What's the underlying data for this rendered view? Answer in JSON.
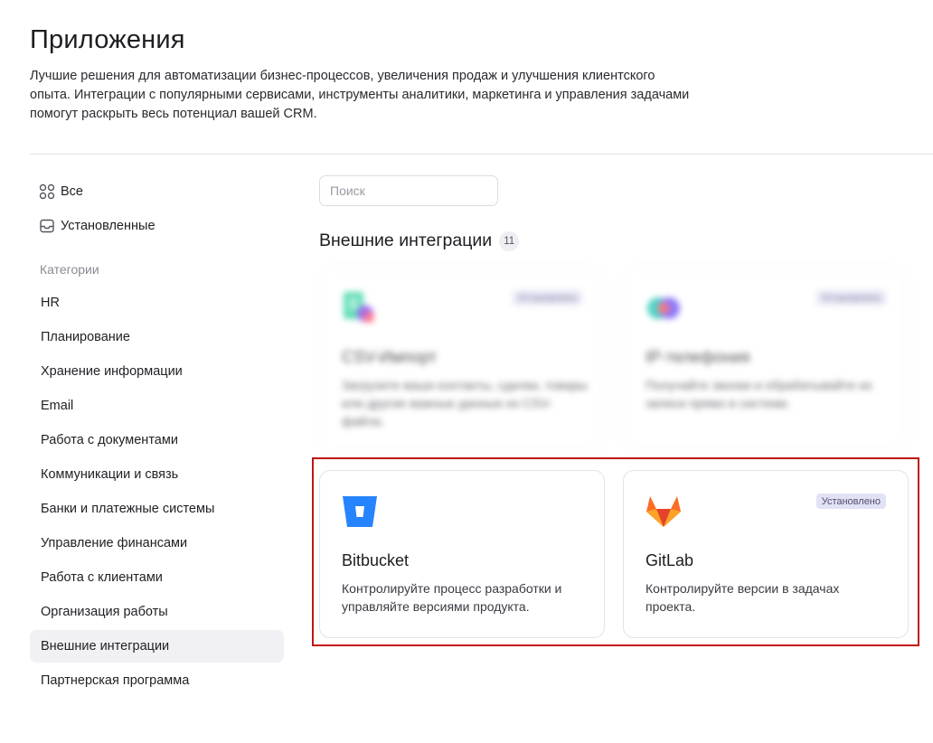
{
  "header": {
    "title": "Приложения",
    "description": "Лучшие решения для автоматизации бизнес-процессов, увеличения продаж и улучшения клиентского опыта. Интеграции с популярными сервисами, инструменты аналитики, маркетинга и управления задачами помогут раскрыть весь потенциал вашей CRM."
  },
  "sidebar": {
    "all_label": "Все",
    "installed_label": "Установленные",
    "categories_title": "Категории",
    "categories": [
      "HR",
      "Планирование",
      "Хранение информации",
      "Email",
      "Работа с документами",
      "Коммуникации и связь",
      "Банки и платежные системы",
      "Управление финансами",
      "Работа с клиентами",
      "Организация работы",
      "Внешние интеграции",
      "Партнерская программа"
    ],
    "active_category": "Внешние интеграции"
  },
  "search": {
    "placeholder": "Поиск",
    "value": ""
  },
  "section": {
    "title": "Внешние интеграции",
    "count": "11"
  },
  "cards": [
    {
      "name": "CSV-Импорт",
      "description": "Загрузите ваши контакты, сделки, товары или другие важные данные из CSV-файла.",
      "badge": "Установлено",
      "blurred": true,
      "icon": "csv-import-icon"
    },
    {
      "name": "IP-телефония",
      "description": "Получайте звонки и обрабатывайте их записи прямо в системе.",
      "badge": "Установлено",
      "blurred": true,
      "icon": "ip-telephony-icon"
    },
    {
      "name": "Bitbucket",
      "description": "Контролируйте процесс разработки и управляйте версиями продукта.",
      "badge": "",
      "blurred": false,
      "icon": "bitbucket-icon"
    },
    {
      "name": "GitLab",
      "description": "Контролируйте версии в задачах проекта.",
      "badge": "Установлено",
      "blurred": false,
      "icon": "gitlab-icon"
    }
  ],
  "colors": {
    "highlight_border": "#c21414",
    "bitbucket_blue": "#2684ff",
    "gitlab_orange": "#e24329",
    "installed_badge_bg": "#e2e2f6",
    "active_nav_bg": "#f1f1f5"
  }
}
